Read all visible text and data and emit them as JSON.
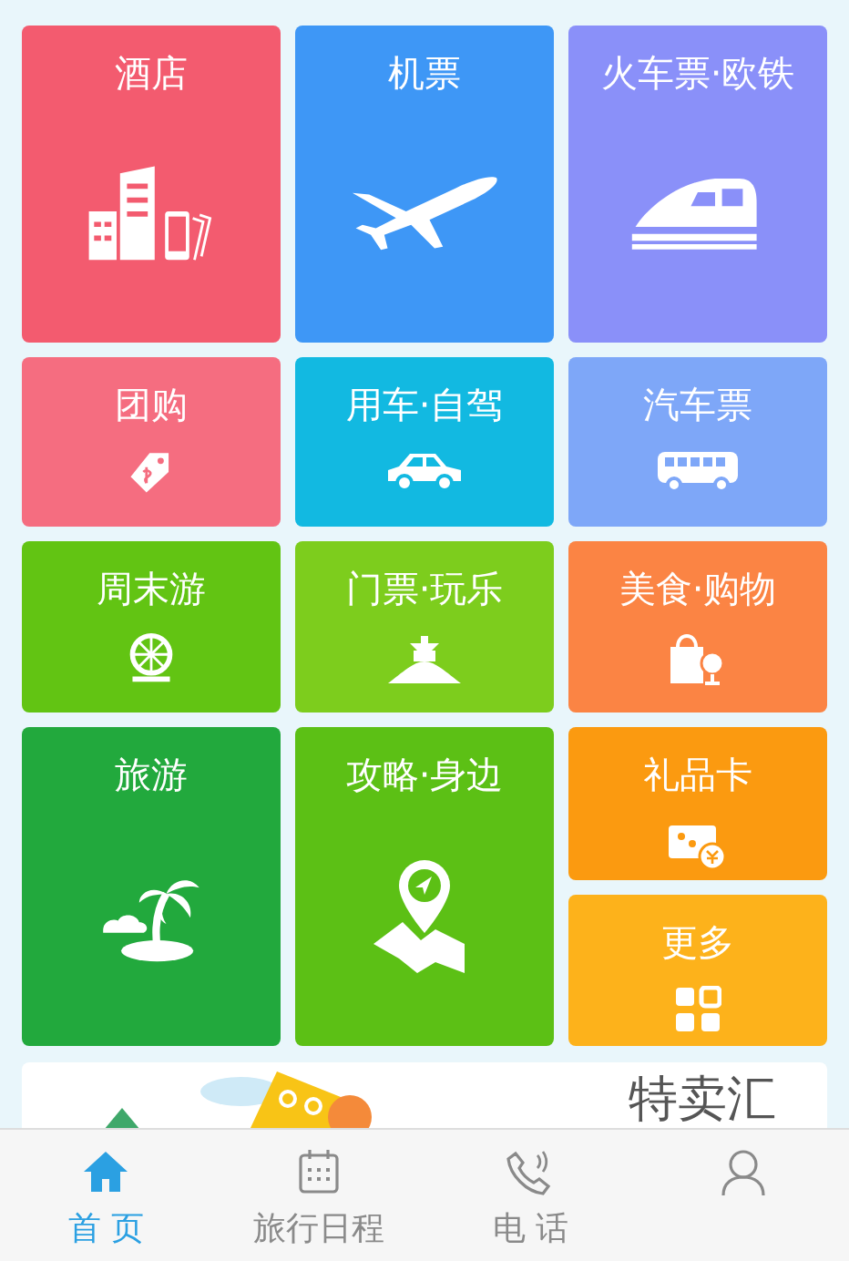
{
  "tiles": [
    {
      "label": "酒店",
      "color": "#f35b6f",
      "kind": "large"
    },
    {
      "label": "机票",
      "color": "#3e97f6",
      "kind": "large"
    },
    {
      "label": "火车票·欧铁",
      "color": "#8a90f9",
      "kind": "large"
    },
    {
      "label": "团购",
      "color": "#f56d80",
      "kind": "small"
    },
    {
      "label": "用车·自驾",
      "color": "#12b9e1",
      "kind": "small"
    },
    {
      "label": "汽车票",
      "color": "#7ea7f8",
      "kind": "small"
    },
    {
      "label": "周末游",
      "color": "#62c413",
      "kind": "small"
    },
    {
      "label": "门票·玩乐",
      "color": "#7dcd1d",
      "kind": "small"
    },
    {
      "label": "美食·购物",
      "color": "#fb8444",
      "kind": "small"
    },
    {
      "label": "旅游",
      "color": "#22a93d",
      "kind": "tall"
    },
    {
      "label": "攻略·身边",
      "color": "#5cc015",
      "kind": "tall"
    },
    {
      "label": "礼品卡",
      "color": "#fb9a10",
      "kind": "small"
    },
    {
      "label": "更多",
      "color": "#fdb21b",
      "kind": "small"
    }
  ],
  "banner": {
    "title": "特卖汇"
  },
  "tab_bar": [
    {
      "label": "首 页",
      "selected": true
    },
    {
      "label": "旅行日程",
      "selected": false
    },
    {
      "label": "电 话",
      "selected": false
    },
    {
      "selected": false
    }
  ]
}
